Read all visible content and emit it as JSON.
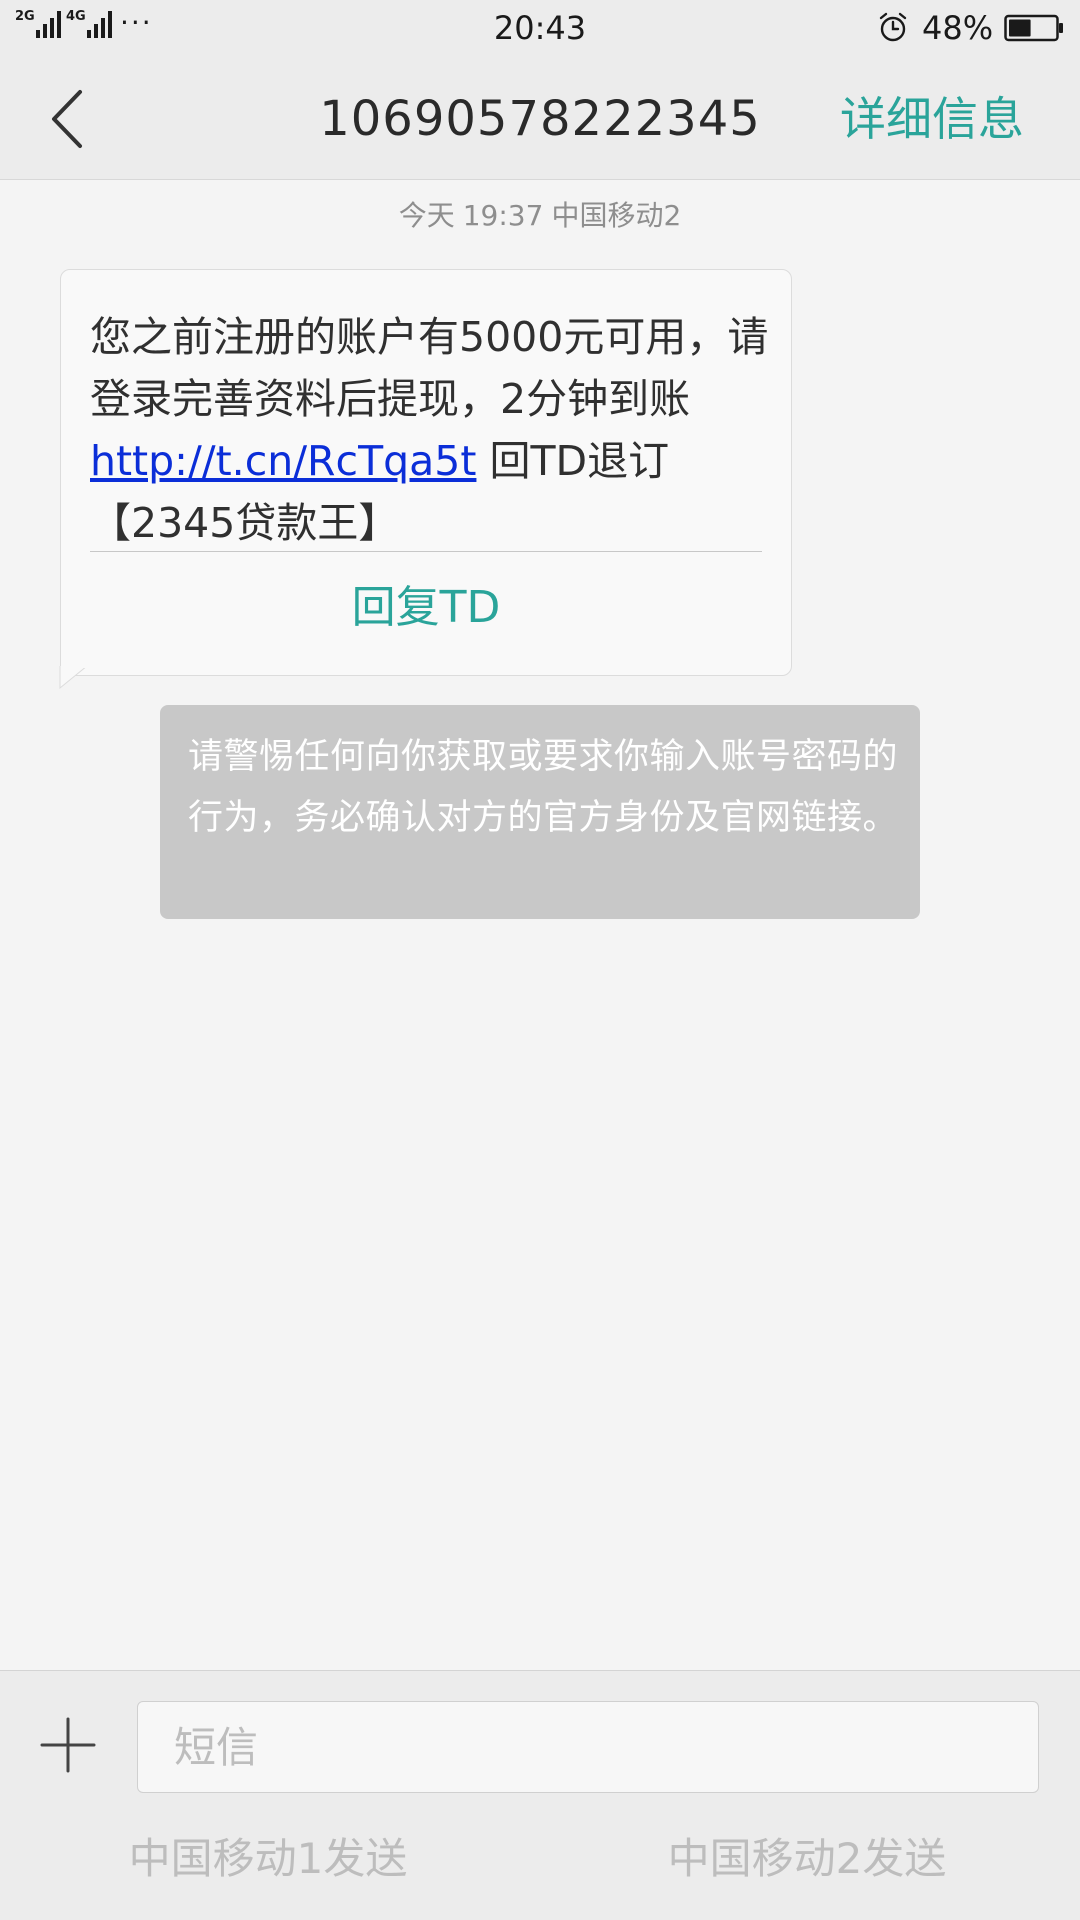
{
  "status_bar": {
    "signal1_label": "2G",
    "signal2_label": "4G",
    "more": "···",
    "time": "20:43",
    "battery_percent": "48%",
    "battery_level": 0.48
  },
  "header": {
    "title": "10690578222345",
    "details_label": "详细信息"
  },
  "conversation": {
    "timestamp": {
      "day": "今天",
      "time": "19:37",
      "sim": "中国移动2"
    },
    "message": {
      "text_before_link": "您之前注册的账户有5000元可用，请登录完善资料后提现，2分钟到账 ",
      "link": "http://t.cn/RcTqa5t",
      "text_after_link": " 回TD退订【2345贷款王】",
      "reply_button": "回复TD"
    },
    "warning": "请警惕任何向你获取或要求你输入账号密码的行为，务必确认对方的官方身份及官网链接。"
  },
  "composer": {
    "placeholder": "短信",
    "send_sim1": "中国移动1发送",
    "send_sim2": "中国移动2发送"
  },
  "colors": {
    "accent": "#2aa49a",
    "link": "#0b2ed8",
    "warning_bg": "#c8c8c8"
  }
}
